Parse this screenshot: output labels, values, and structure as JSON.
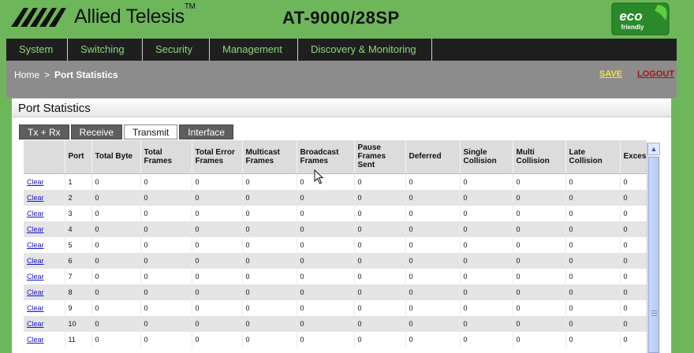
{
  "header": {
    "brand": "Allied Telesis",
    "trademark": "TM",
    "model": "AT-9000/28SP",
    "eco_badge": {
      "top": "eco",
      "bottom": "friendly"
    }
  },
  "nav": {
    "items": [
      "System",
      "Switching",
      "Security",
      "Management",
      "Discovery & Monitoring"
    ]
  },
  "breadcrumb": {
    "home": "Home",
    "separator": ">",
    "current": "Port Statistics"
  },
  "actions": {
    "save": "SAVE",
    "logout": "LOGOUT"
  },
  "panel": {
    "title": "Port Statistics"
  },
  "tabs": [
    {
      "label": "Tx + Rx",
      "active": false
    },
    {
      "label": "Receive",
      "active": false
    },
    {
      "label": "Transmit",
      "active": true
    },
    {
      "label": "Interface",
      "active": false
    }
  ],
  "table": {
    "columns": [
      "",
      "Port",
      "Total Byte",
      "Total Frames",
      "Total Error Frames",
      "Multicast Frames",
      "Broadcast Frames",
      "Pause Frames Sent",
      "Deferred",
      "Single Collision",
      "Multi Collision",
      "Late Collision",
      "Excessive Collision"
    ],
    "clear_label": "Clear",
    "rows": [
      {
        "port": "1",
        "values": [
          "0",
          "0",
          "0",
          "0",
          "0",
          "0",
          "0",
          "0",
          "0",
          "0",
          "0"
        ]
      },
      {
        "port": "2",
        "values": [
          "0",
          "0",
          "0",
          "0",
          "0",
          "0",
          "0",
          "0",
          "0",
          "0",
          "0"
        ]
      },
      {
        "port": "3",
        "values": [
          "0",
          "0",
          "0",
          "0",
          "0",
          "0",
          "0",
          "0",
          "0",
          "0",
          "0"
        ]
      },
      {
        "port": "4",
        "values": [
          "0",
          "0",
          "0",
          "0",
          "0",
          "0",
          "0",
          "0",
          "0",
          "0",
          "0"
        ]
      },
      {
        "port": "5",
        "values": [
          "0",
          "0",
          "0",
          "0",
          "0",
          "0",
          "0",
          "0",
          "0",
          "0",
          "0"
        ]
      },
      {
        "port": "6",
        "values": [
          "0",
          "0",
          "0",
          "0",
          "0",
          "0",
          "0",
          "0",
          "0",
          "0",
          "0"
        ]
      },
      {
        "port": "7",
        "values": [
          "0",
          "0",
          "0",
          "0",
          "0",
          "0",
          "0",
          "0",
          "0",
          "0",
          "0"
        ]
      },
      {
        "port": "8",
        "values": [
          "0",
          "0",
          "0",
          "0",
          "0",
          "0",
          "0",
          "0",
          "0",
          "0",
          "0"
        ]
      },
      {
        "port": "9",
        "values": [
          "0",
          "0",
          "0",
          "0",
          "0",
          "0",
          "0",
          "0",
          "0",
          "0",
          "0"
        ]
      },
      {
        "port": "10",
        "values": [
          "0",
          "0",
          "0",
          "0",
          "0",
          "0",
          "0",
          "0",
          "0",
          "0",
          "0"
        ]
      },
      {
        "port": "11",
        "values": [
          "0",
          "0",
          "0",
          "0",
          "0",
          "0",
          "0",
          "0",
          "0",
          "0",
          "0"
        ]
      }
    ]
  },
  "colors": {
    "background": "#6db65a",
    "nav_bg": "#1f1f1f",
    "nav_text": "#8fd47d",
    "save": "#f2e23a",
    "logout": "#b01010",
    "link": "#1515c8"
  },
  "icons": [
    "allied-telesis-logo-icon",
    "eco-friendly-badge-icon",
    "scroll-up-icon",
    "mouse-pointer-icon"
  ]
}
